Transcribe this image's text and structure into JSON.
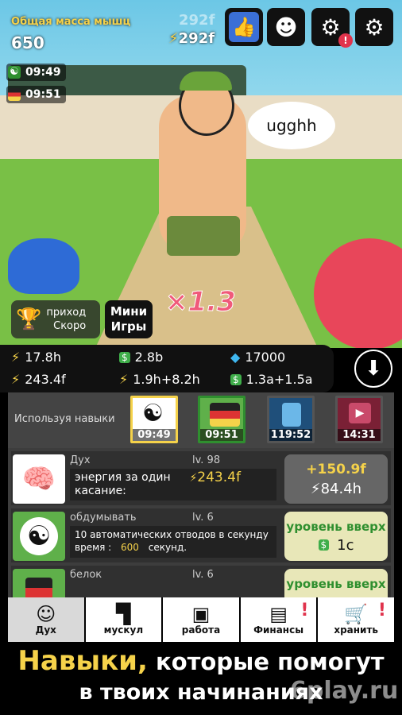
{
  "hud": {
    "mass_label": "Общая масса мышц",
    "mass_value": "650",
    "energy_ghost": "292f",
    "energy_value": "292f",
    "timers": [
      {
        "icon": "yin-yang-icon",
        "time": "09:49"
      },
      {
        "icon": "protein-jar-icon",
        "time": "09:51"
      }
    ]
  },
  "speech": "ugghh",
  "multiplier": "×1.3",
  "income_button": {
    "line1": "приход",
    "line2": "Скоро"
  },
  "mini_games": {
    "line1": "Мини",
    "line2": "Игры"
  },
  "stats": {
    "energy": "17.8h",
    "cash": "2.8b",
    "gems": "17000",
    "tap_energy": "243.4f",
    "energy_time": "1.9h+8.2h",
    "cash_time": "1.3a+1.5a"
  },
  "skills": {
    "label": "Используя навыки",
    "slots": [
      {
        "icon": "yin-yang-icon",
        "time": "09:49",
        "active": true
      },
      {
        "icon": "protein-jar-icon",
        "time": "09:51",
        "active": false
      },
      {
        "icon": "water-bottle-icon",
        "time": "119:52",
        "active": false
      },
      {
        "icon": "video-icon",
        "time": "14:31",
        "active": false
      }
    ]
  },
  "items": [
    {
      "name": "Дух",
      "level": "lv. 98",
      "desc": "энергия за один касание:",
      "desc_value": "243.4f",
      "btn_top": "+150.9f",
      "btn_bottom": "84.4h"
    },
    {
      "name": "обдумывать",
      "level": "lv. 6",
      "desc": "10 автоматических отводов в секунду",
      "desc2_label": "время :",
      "desc2_value": "600",
      "desc2_unit": "секунд.",
      "btn_top": "уровень вверх",
      "btn_bottom": "1c"
    },
    {
      "name": "белок",
      "level": "lv. 6",
      "btn_top": "уровень вверх"
    }
  ],
  "nav": [
    {
      "label": "Дух",
      "icon": "head-icon",
      "alert": false
    },
    {
      "label": "мускул",
      "icon": "shorts-icon",
      "alert": false
    },
    {
      "label": "работа",
      "icon": "briefcase-icon",
      "alert": false
    },
    {
      "label": "Финансы",
      "icon": "cash-icon",
      "alert": true
    },
    {
      "label": "хранить",
      "icon": "cart-icon",
      "alert": true
    }
  ],
  "caption": {
    "highlight": "Навыки,",
    "rest": "которые помогут",
    "line2": "в твоих начинаниях"
  },
  "watermark": "6play.ru",
  "colors": {
    "accent": "#f5d24a",
    "green": "#2f8f2f",
    "alert": "#e0334c"
  }
}
